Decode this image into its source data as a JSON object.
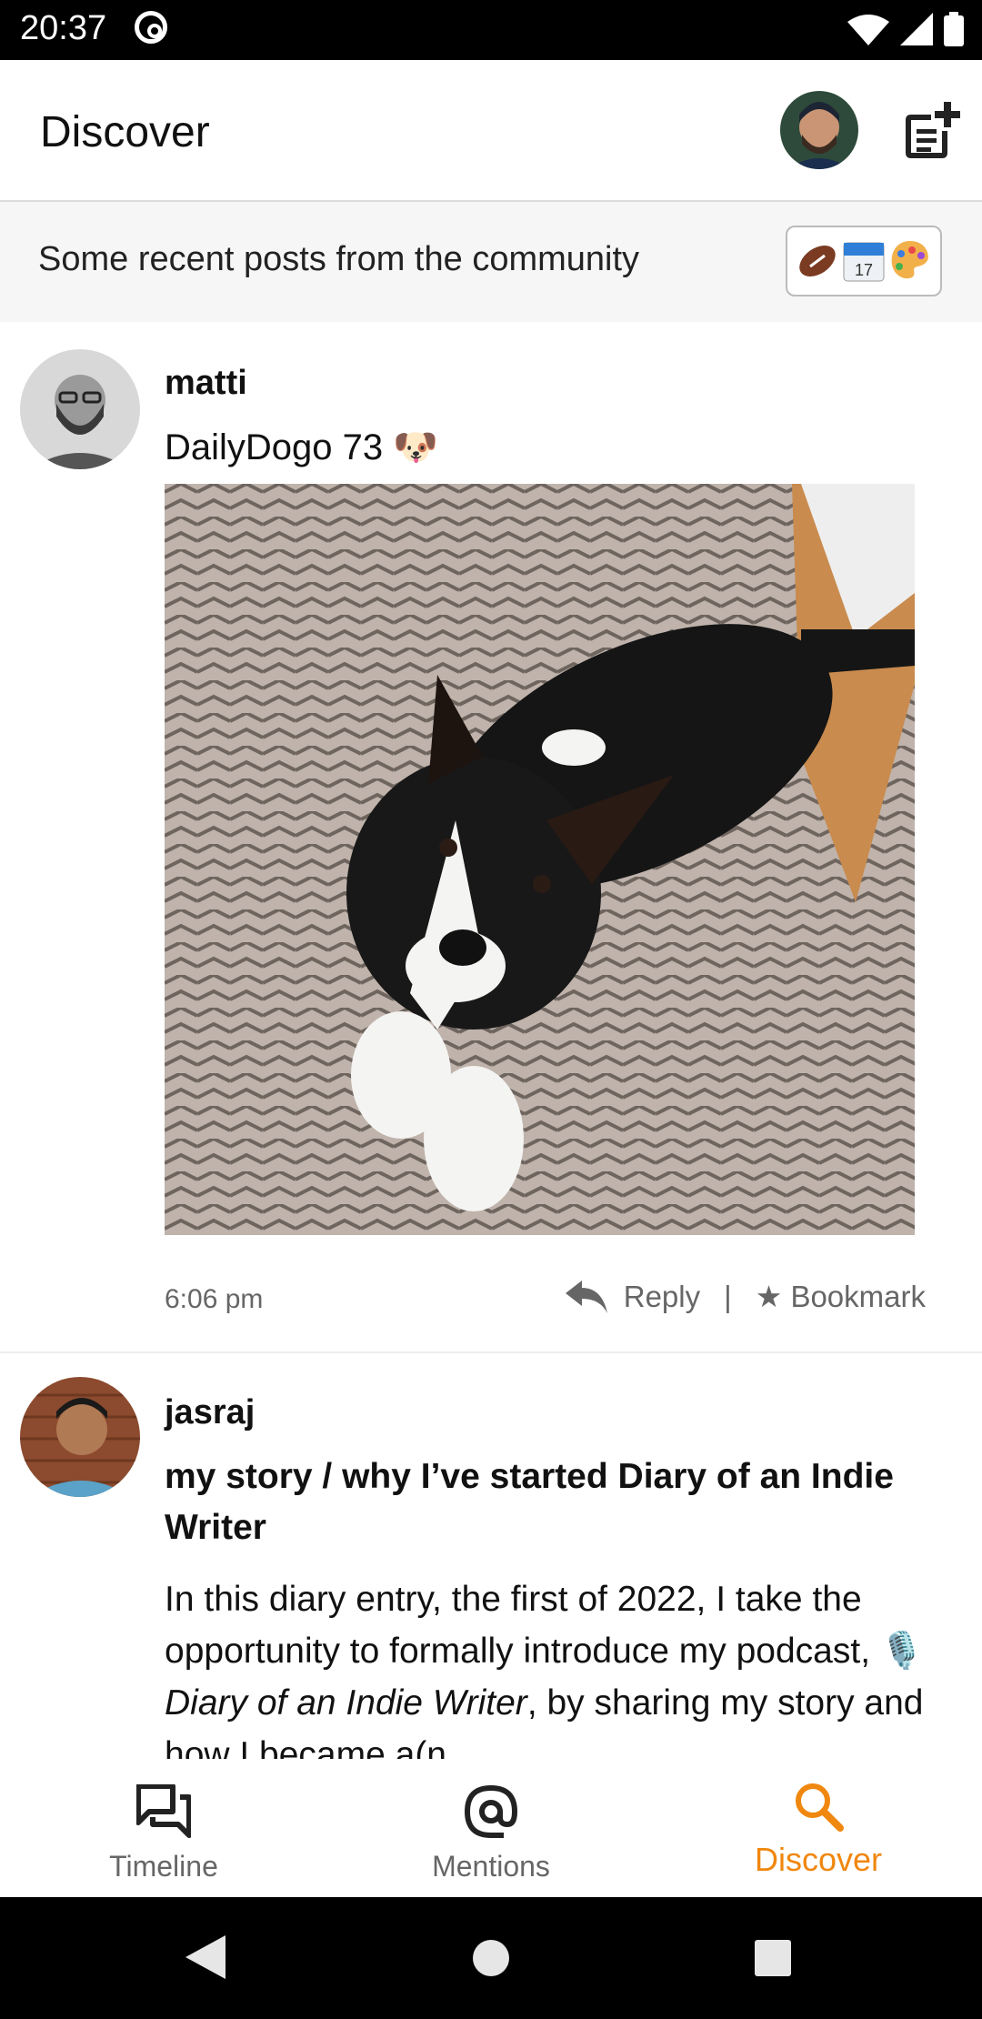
{
  "status_bar": {
    "time": "20:37"
  },
  "header": {
    "title": "Discover"
  },
  "banner": {
    "text": "Some recent posts from the community"
  },
  "posts": [
    {
      "username": "matti",
      "text": "DailyDogo 73 🐶",
      "time": "6:06 pm",
      "reply_label": "Reply",
      "separator": "|",
      "bookmark_label": "★ Bookmark"
    },
    {
      "username": "jasraj",
      "title": "my story / why I’ve started Diary of an Indie Writer",
      "body_before": "In this diary entry, the first of 2022, I take the opportunity to formally introduce my podcast, 🎙️ ",
      "body_italic": "Diary of an Indie Writer",
      "body_after": ", by sharing my story and how I became a(n"
    }
  ],
  "bottom_nav": {
    "items": [
      {
        "label": "Timeline",
        "icon": "forum-icon"
      },
      {
        "label": "Mentions",
        "icon": "at-icon"
      },
      {
        "label": "Discover",
        "icon": "search-icon",
        "active": true
      }
    ]
  },
  "colors": {
    "accent": "#f0870f",
    "secondary_text": "#666666"
  }
}
